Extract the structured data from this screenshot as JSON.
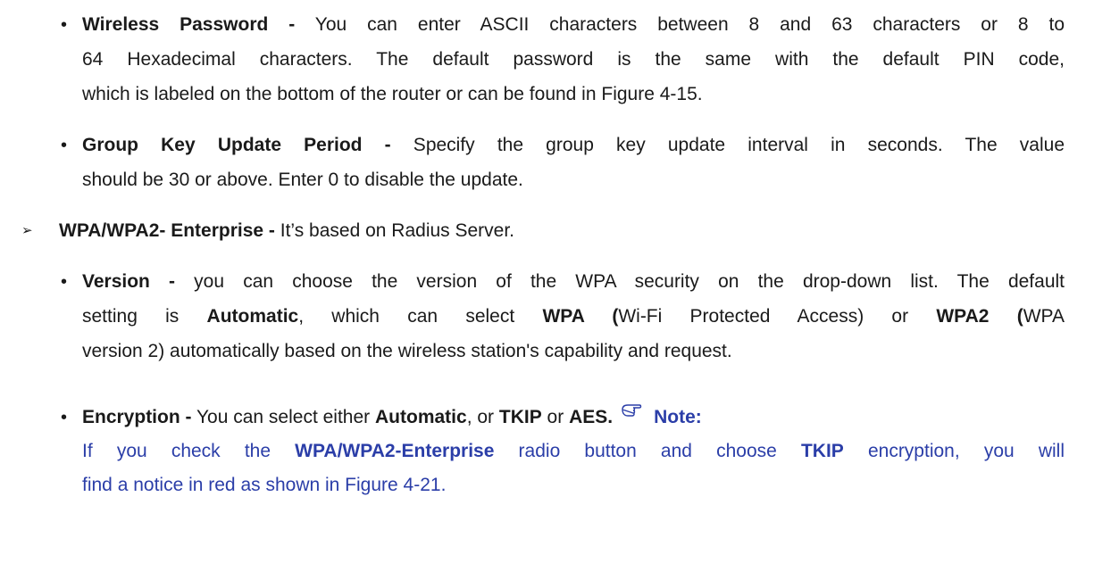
{
  "colors": {
    "text": "#1a1a1a",
    "note": "#2b3ea8"
  },
  "sections": {
    "wireless_password": {
      "term": "Wireless Password -",
      "line1": " You can enter ASCII characters between 8 and 63 characters or 8 to",
      "line2": "64 Hexadecimal characters. The default password is the same with the default PIN code,",
      "line3": "which is labeled on the bottom of the router or can be found in Figure 4-15."
    },
    "group_key": {
      "term": "Group Key Update Period -",
      "line1": " Specify the group key update interval in seconds. The value",
      "line2": "should be 30 or above. Enter 0 to disable the update."
    },
    "enterprise": {
      "term": "WPA/WPA2- Enterprise -",
      "rest": " It’s based on Radius Server."
    },
    "version": {
      "term": "Version  -",
      "line1": " you can choose the version of the WPA security on the drop-down list. The default",
      "l2_a": "setting is ",
      "l2_b": "Automatic",
      "l2_c": ", which can select  ",
      "l2_d": "WPA (",
      "l2_e": "Wi-Fi Protected Access) or ",
      "l2_f": "WPA2 (",
      "l2_g": "WPA",
      "line3": "version 2) automatically based on the wireless station's capability and request."
    },
    "encryption": {
      "term": "Encryption -",
      "a": "  You can select either ",
      "b": "Automatic",
      "c": ", or ",
      "d": "TKIP",
      "e": " or ",
      "f": "AES.",
      "note_label": "Note:",
      "note_icon": "pointing-hand-icon",
      "n1_a": "If you check the ",
      "n1_b": "WPA/WPA2-Enterprise",
      "n1_c": " radio button and choose ",
      "n1_d": "TKIP",
      "n1_e": " encryption, you will",
      "n2": "find a notice in red as shown in Figure 4-21."
    }
  }
}
